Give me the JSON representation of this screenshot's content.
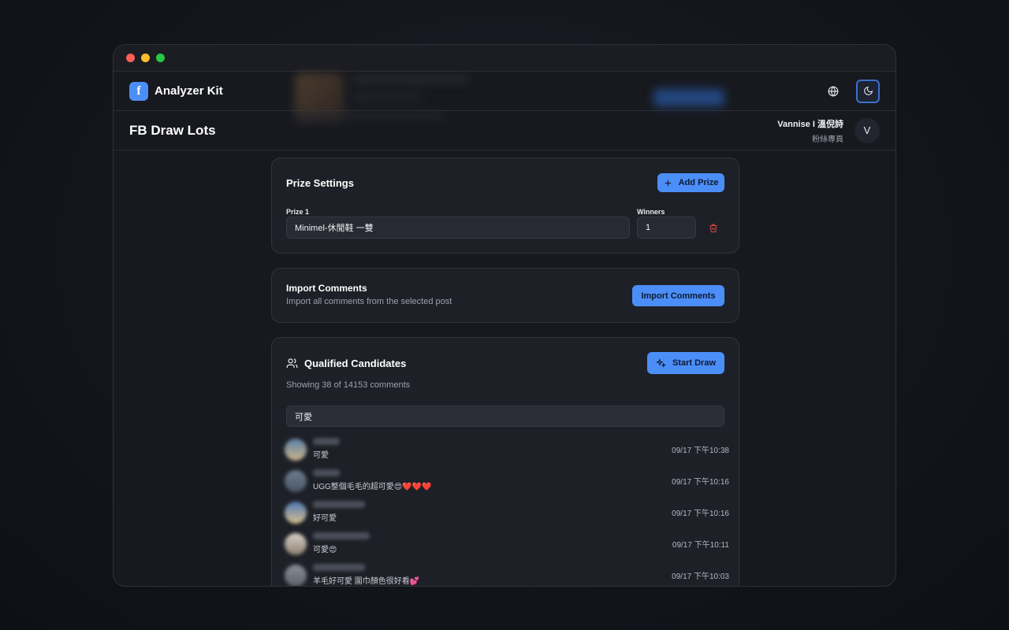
{
  "app": {
    "brand_name": "Analyzer Kit",
    "brand_logo": "f"
  },
  "page": {
    "title": "FB Draw Lots"
  },
  "account": {
    "name": "Vannise I 溫倪詩",
    "type": "粉絲專頁",
    "initial": "V"
  },
  "prize_settings": {
    "title": "Prize Settings",
    "add_button": "Add Prize",
    "prize_label": "Prize 1",
    "prize_value": "Minimel-休閒鞋 一雙",
    "winners_label": "Winners",
    "winners_value": "1"
  },
  "import": {
    "title": "Import Comments",
    "subtitle": "Import all comments from the selected post",
    "button": "Import Comments"
  },
  "candidates": {
    "title": "Qualified Candidates",
    "start_button": "Start Draw",
    "summary": "Showing 38 of 14153 comments",
    "filter_value": "可愛",
    "rows": [
      {
        "message": "可愛",
        "time": "09/17 下午10:38"
      },
      {
        "message": "UGG整個毛毛的超可愛😍❤️❤️❤️",
        "time": "09/17 下午10:16"
      },
      {
        "message": "好可愛",
        "time": "09/17 下午10:16"
      },
      {
        "message": "可愛😍",
        "time": "09/17 下午10:11"
      },
      {
        "message": "羊毛好可愛 圍巾顏色很好看💕",
        "time": "09/17 下午10:03"
      }
    ]
  },
  "colors": {
    "accent": "#4c8ef7",
    "danger": "#d94a4a",
    "card_bg": "#1e2027"
  }
}
